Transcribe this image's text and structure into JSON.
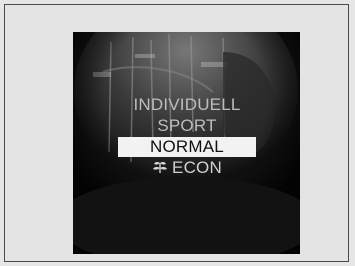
{
  "mode_menu": {
    "items": [
      {
        "label": "INDIVIDUELL",
        "selected": false
      },
      {
        "label": "SPORT",
        "selected": false
      },
      {
        "label": "NORMAL",
        "selected": true
      },
      {
        "label": "ECON",
        "selected": false,
        "icon": "econ-leaf-icon"
      }
    ],
    "highlight_color": "#f2f2f2",
    "text_color": "#bdbdbd"
  }
}
